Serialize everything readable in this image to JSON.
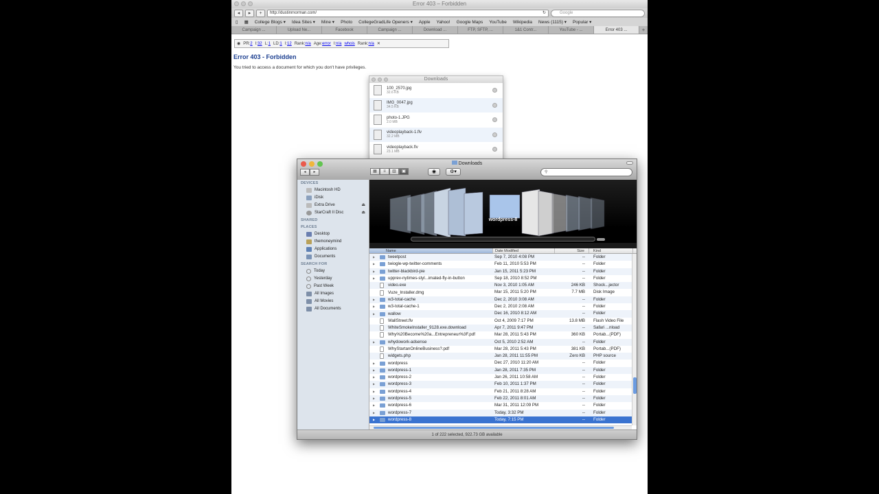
{
  "browser": {
    "window_title": "Error 403 – Forbidden",
    "url": "http://dustinrnorman.com/",
    "search_placeholder": "Google",
    "bookmarks": [
      "College Blogs ▾",
      "Idea Sites ▾",
      "Mine ▾",
      "Photo",
      "CollegeGradLife Openers ▾",
      "Apple",
      "Yahoo!",
      "Google Maps",
      "YouTube",
      "Wikipedia",
      "News (1115) ▾",
      "Popular ▾"
    ],
    "tabs": [
      "Campaign ...",
      "Upload Ne...",
      "Facebook",
      "Campaign ...",
      "Download ...",
      "FTP, SFTP, ...",
      "1&1 Contr...",
      "YouTube - ...",
      "Error 403 ..."
    ],
    "active_tab": 8
  },
  "seobar": {
    "items": [
      {
        "k": "PR:",
        "v": "2"
      },
      {
        "k": "I:",
        "v": "32"
      },
      {
        "k": "L:",
        "v": "1"
      },
      {
        "k": "LD:",
        "v": "1"
      },
      {
        "k": "I:",
        "v": "12"
      },
      {
        "k": "Rank:",
        "v": "n/a"
      },
      {
        "k": "Age:",
        "v": "error"
      },
      {
        "k": "I:",
        "v": "n/a"
      },
      {
        "k": "",
        "v": "whois"
      },
      {
        "k": "Rank:",
        "v": "n/a"
      }
    ]
  },
  "page": {
    "heading": "Error 403 - Forbidden",
    "body": "You tried to access a document for which you don't have privileges."
  },
  "downloads": {
    "title": "Downloads",
    "items": [
      {
        "name": "100_2570.jpg",
        "size": "32.6 KB"
      },
      {
        "name": "IMG_0047.jpg",
        "size": "34.5 KB"
      },
      {
        "name": "photo-1.JPG",
        "size": "2.0 MB"
      },
      {
        "name": "videoplayback-1.flv",
        "size": "32.2 MB"
      },
      {
        "name": "videoplayback.flv",
        "size": "23.1 MB"
      }
    ]
  },
  "finder": {
    "title": "Downloads",
    "sidebar": {
      "devices_label": "DEVICES",
      "devices": [
        "Macintosh HD",
        "iDisk",
        "Extra Drive",
        "StarCraft II Disc"
      ],
      "shared_label": "SHARED",
      "places_label": "PLACES",
      "places": [
        "Desktop",
        "themoneymind",
        "Applications",
        "Documents"
      ],
      "search_label": "SEARCH FOR",
      "searches": [
        "Today",
        "Yesterday",
        "Past Week",
        "All Images",
        "All Movies",
        "All Documents"
      ]
    },
    "coverflow_label": "wordpress-8",
    "columns": {
      "name": "Name",
      "date": "Date Modified",
      "size": "Size",
      "kind": "Kind"
    },
    "rows": [
      {
        "name": "tweetpost",
        "date": "Sep 7, 2010 4:08 PM",
        "size": "--",
        "kind": "Folder",
        "folder": true
      },
      {
        "name": "twiogle-wp-twitter-comments",
        "date": "Feb 11, 2010 5:53 PM",
        "size": "--",
        "kind": "Folder",
        "folder": true
      },
      {
        "name": "twitter-blackbird-pie",
        "date": "Jan 15, 2011 5:23 PM",
        "size": "--",
        "kind": "Folder",
        "folder": true
      },
      {
        "name": "upprev-nytimes-styl...imated-fly-in-button",
        "date": "Sep 18, 2010 8:52 PM",
        "size": "--",
        "kind": "Folder",
        "folder": true
      },
      {
        "name": "video.exe",
        "date": "Nov 3, 2010 1:05 AM",
        "size": "246 KB",
        "kind": "Shock...jector",
        "folder": false
      },
      {
        "name": "Vuze_Installer.dmg",
        "date": "Mar 15, 2011 5:20 PM",
        "size": "7.7 MB",
        "kind": "Disk Image",
        "folder": false
      },
      {
        "name": "w3-total-cache",
        "date": "Dec 2, 2010 3:08 AM",
        "size": "--",
        "kind": "Folder",
        "folder": true
      },
      {
        "name": "w3-total-cache-1",
        "date": "Dec 2, 2010 2:08 AM",
        "size": "--",
        "kind": "Folder",
        "folder": true
      },
      {
        "name": "wallow",
        "date": "Dec 16, 2010 8:12 AM",
        "size": "--",
        "kind": "Folder",
        "folder": true
      },
      {
        "name": "WallStreet.flv",
        "date": "Oct 4, 2009 7:17 PM",
        "size": "13.8 MB",
        "kind": "Flash Video File",
        "folder": false
      },
      {
        "name": "WhiteSmokeInstaller_9128.exe.download",
        "date": "Apr 7, 2011 9:47 PM",
        "size": "--",
        "kind": "Safari ...nload",
        "folder": false
      },
      {
        "name": "Why%20Become%20a...Entrepreneur%3F.pdf",
        "date": "Mar 28, 2011 5:43 PM",
        "size": "360 KB",
        "kind": "Portab...(PDF)",
        "folder": false
      },
      {
        "name": "whydowork-adsense",
        "date": "Oct 5, 2010 2:52 AM",
        "size": "--",
        "kind": "Folder",
        "folder": true
      },
      {
        "name": "WhyStartanOnlineBusiness?.pdf",
        "date": "Mar 28, 2011 5:43 PM",
        "size": "381 KB",
        "kind": "Portab...(PDF)",
        "folder": false
      },
      {
        "name": "widgets.php",
        "date": "Jan 28, 2011 11:55 PM",
        "size": "Zero KB",
        "kind": "PHP source",
        "folder": false
      },
      {
        "name": "wordpress",
        "date": "Dec 27, 2010 11:20 AM",
        "size": "--",
        "kind": "Folder",
        "folder": true
      },
      {
        "name": "wordpress-1",
        "date": "Jan 28, 2011 7:35 PM",
        "size": "--",
        "kind": "Folder",
        "folder": true
      },
      {
        "name": "wordpress-2",
        "date": "Jan 26, 2011 10:58 AM",
        "size": "--",
        "kind": "Folder",
        "folder": true
      },
      {
        "name": "wordpress-3",
        "date": "Feb 10, 2011 1:37 PM",
        "size": "--",
        "kind": "Folder",
        "folder": true
      },
      {
        "name": "wordpress-4",
        "date": "Feb 21, 2011 8:28 AM",
        "size": "--",
        "kind": "Folder",
        "folder": true
      },
      {
        "name": "wordpress-5",
        "date": "Feb 22, 2011 8:01 AM",
        "size": "--",
        "kind": "Folder",
        "folder": true
      },
      {
        "name": "wordpress-6",
        "date": "Mar 31, 2011 12:09 PM",
        "size": "--",
        "kind": "Folder",
        "folder": true
      },
      {
        "name": "wordpress-7",
        "date": "Today, 3:32 PM",
        "size": "--",
        "kind": "Folder",
        "folder": true
      },
      {
        "name": "wordpress-8",
        "date": "Today, 7:15 PM",
        "size": "--",
        "kind": "Folder",
        "folder": true
      }
    ],
    "selected_index": 23,
    "status": "1 of 222 selected, 922.73 GB available"
  },
  "colors": {
    "selection": "#3a73d0",
    "heading": "#1a3d8f"
  }
}
